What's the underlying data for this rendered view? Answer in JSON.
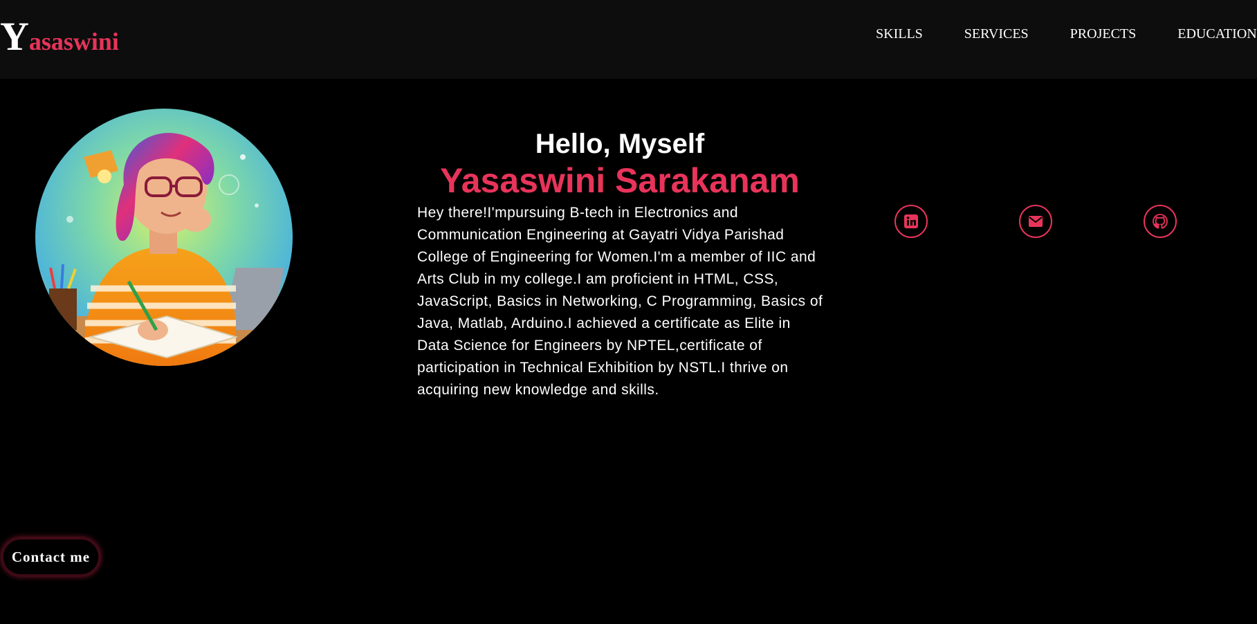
{
  "brand": {
    "initial": "Y",
    "rest": "asaswini"
  },
  "nav": {
    "items": [
      "SKILLS",
      "SERVICES",
      "PROJECTS",
      "EDUCATION"
    ]
  },
  "hero": {
    "greeting": "Hello, Myself",
    "name": "Yasaswini Sarakanam",
    "bio": "Hey there!I'mpursuing B-tech in Electronics and Communication Engineering at Gayatri Vidya Parishad College of Engineering for Women.I'm a member of IIC and Arts Club in my college.I am proficient in HTML, CSS, JavaScript, Basics in Networking, C Programming, Basics of Java, Matlab, Arduino.I achieved a certificate as Elite in Data Science for Engineers by NPTEL,certificate of participation in Technical Exhibition by NSTL.I thrive on acquiring new knowledge and skills."
  },
  "social": [
    {
      "icon": "linkedin-icon"
    },
    {
      "icon": "mail-icon"
    },
    {
      "icon": "github-icon"
    }
  ],
  "contact": {
    "label": "Contact me"
  },
  "colors": {
    "accent": "#e8345a",
    "background": "#000000",
    "header": "#0d0d0d"
  }
}
